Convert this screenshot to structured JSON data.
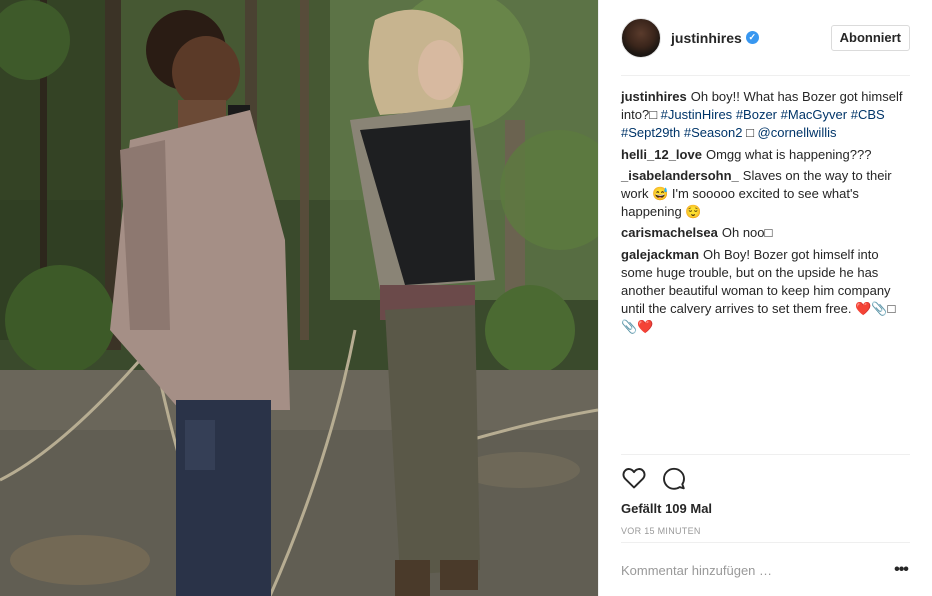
{
  "post": {
    "username": "justinhires",
    "verified_icon": "verified-badge-icon",
    "follow_label": "Abonniert",
    "caption": {
      "author": "justinhires",
      "text_start": "Oh boy!! What has Bozer got himself into?□ ",
      "tags": [
        "#JustinHires",
        "#Bozer",
        "#MacGyver",
        "#CBS",
        "#Sept29th",
        "#Season2"
      ],
      "tail": " □ ",
      "mention": "@cornellwillis"
    },
    "comments": [
      {
        "author": "helli_12_love",
        "text": "Omgg what is happening???"
      },
      {
        "author": "_isabelandersohn_",
        "text": "Slaves on the way to their work 😅 I'm sooooo excited to see what's happening 😌"
      },
      {
        "author": "carismachelsea",
        "text": "Oh noo□"
      },
      {
        "author": "galejackman",
        "text": "Oh Boy! Bozer got himself into some huge trouble, but on the upside he has another beautiful woman to keep him company until the calvery arrives to set them free. ❤️📎□📎❤️"
      }
    ],
    "likes": "Gefällt 109 Mal",
    "timestamp": "VOR 15 MINUTEN",
    "comment_placeholder": "Kommentar hinzufügen …",
    "more_label": "•••",
    "icons": {
      "like": "heart-icon",
      "comment": "comment-bubble-icon"
    }
  },
  "colors": {
    "link": "#003569",
    "verified": "#3897f0",
    "muted": "#999999",
    "border": "#efefef"
  }
}
